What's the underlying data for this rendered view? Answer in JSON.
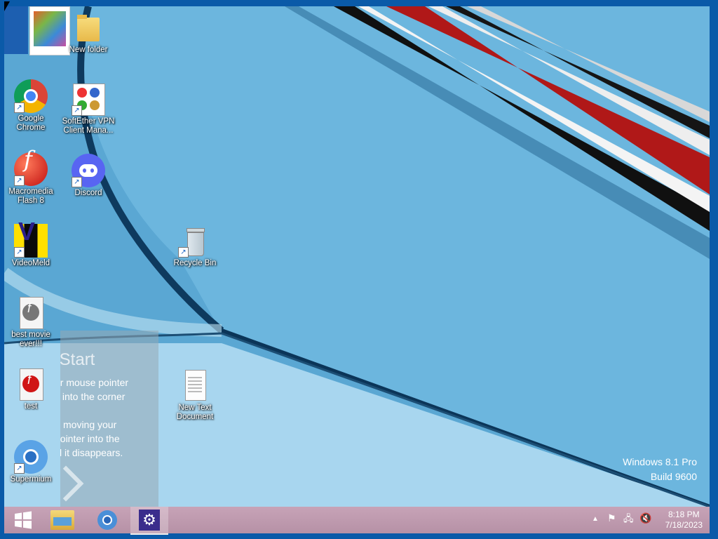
{
  "desktop_icons": [
    {
      "label": "New folder"
    },
    {
      "label": "Google Chrome"
    },
    {
      "label": "SoftEther VPN Client Mana..."
    },
    {
      "label": "Macromedia Flash 8"
    },
    {
      "label": "Discord"
    },
    {
      "label": "VideoMeld"
    },
    {
      "label": "Recycle Bin"
    },
    {
      "label": "best movie ever!!!"
    },
    {
      "label": "test"
    },
    {
      "label": "New Text Document"
    },
    {
      "label": "Supermium"
    }
  ],
  "start_tip": {
    "heading": "s Start",
    "line1": "ur mouse pointer",
    "line2": "y into the corner",
    "line3": "moving your",
    "line4": "pointer into the",
    "line5": "til it disappears."
  },
  "watermark": {
    "edition": "Windows 8.1 Pro",
    "build": "Build 9600"
  },
  "clock": {
    "time": "8:18 PM",
    "date": "7/18/2023"
  },
  "taskbar": {
    "items": [
      "start-button",
      "file-explorer",
      "supermium",
      "control-panel"
    ]
  },
  "colors": {
    "taskbar": "#bf9aaf",
    "frame": "#0a5aa8",
    "wallpaper": "#62acd5"
  }
}
